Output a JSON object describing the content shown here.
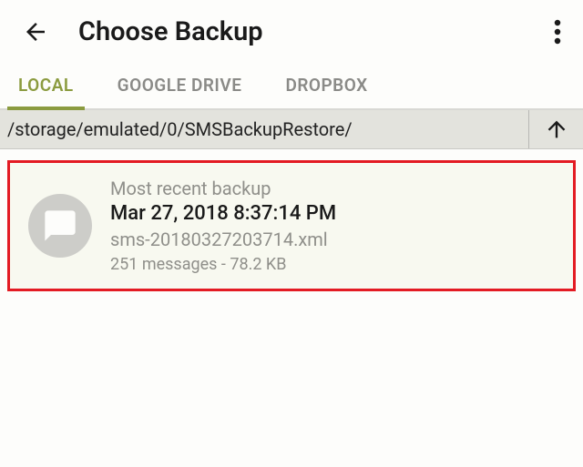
{
  "header": {
    "title": "Choose Backup"
  },
  "tabs": {
    "local": "LOCAL",
    "google_drive": "GOOGLE DRIVE",
    "dropbox": "DROPBOX"
  },
  "path": "/storage/emulated/0/SMSBackupRestore/",
  "backup": {
    "recent_label": "Most recent backup",
    "date": "Mar 27, 2018 8:37:14 PM",
    "filename": "sms-20180327203714.xml",
    "meta": "251 messages - 78.2 KB"
  }
}
